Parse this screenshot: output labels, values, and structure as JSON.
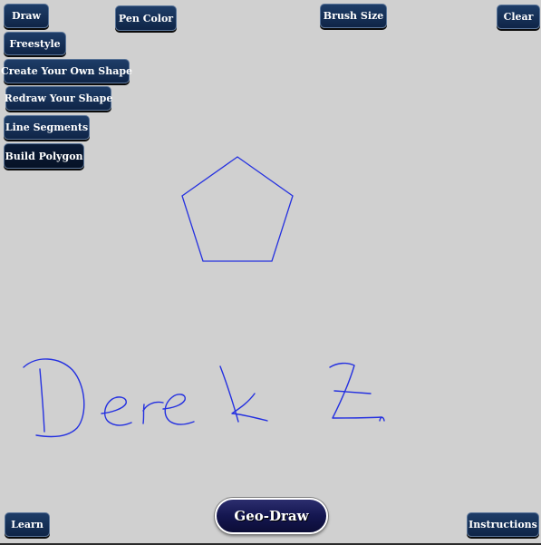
{
  "toolbar": {
    "draw": "Draw",
    "pen_color": "Pen Color",
    "brush_size": "Brush Size",
    "clear": "Clear"
  },
  "draw_menu": {
    "freestyle": "Freestyle",
    "create_shape": "Create Your Own Shape",
    "redraw_shape": "Redraw Your Shape",
    "line_segments": "Line Segments",
    "build_polygon": "Build Polygon",
    "active_item": "Build Polygon"
  },
  "footer": {
    "learn": "Learn",
    "logo": "Geo-Draw",
    "instructions": "Instructions"
  },
  "canvas": {
    "pen_color": "#2430e0",
    "background_color": "#d0d0d0",
    "shapes": [
      "pentagon"
    ],
    "freehand_text": "Derek Z."
  },
  "colors": {
    "button_bg": "#1e3d68",
    "button_text": "#ffffff",
    "logo_bg": "#141650"
  }
}
